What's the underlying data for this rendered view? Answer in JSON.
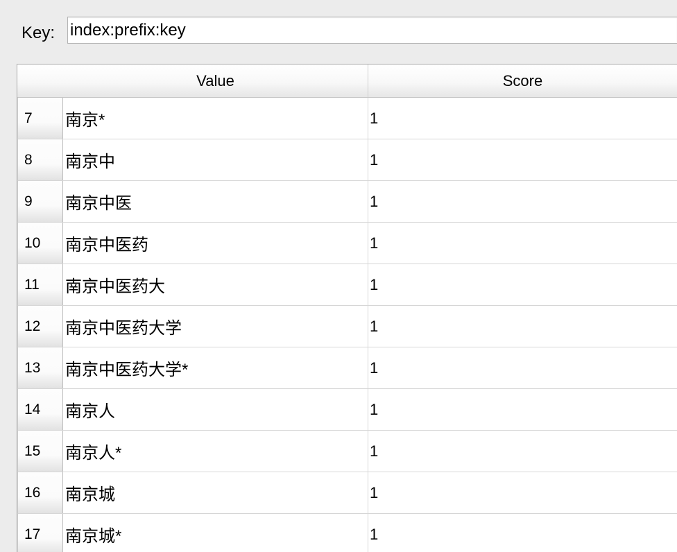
{
  "key": {
    "label": "Key:",
    "value": "index:prefix:key"
  },
  "table": {
    "columns": [
      "Value",
      "Score"
    ],
    "rows": [
      {
        "index": "7",
        "value": "南京*",
        "score": "1"
      },
      {
        "index": "8",
        "value": "南京中",
        "score": "1"
      },
      {
        "index": "9",
        "value": "南京中医",
        "score": "1"
      },
      {
        "index": "10",
        "value": "南京中医药",
        "score": "1"
      },
      {
        "index": "11",
        "value": "南京中医药大",
        "score": "1"
      },
      {
        "index": "12",
        "value": "南京中医药大学",
        "score": "1"
      },
      {
        "index": "13",
        "value": "南京中医药大学*",
        "score": "1"
      },
      {
        "index": "14",
        "value": "南京人",
        "score": "1"
      },
      {
        "index": "15",
        "value": "南京人*",
        "score": "1"
      },
      {
        "index": "16",
        "value": "南京城",
        "score": "1"
      },
      {
        "index": "17",
        "value": "南京城*",
        "score": "1"
      }
    ]
  }
}
